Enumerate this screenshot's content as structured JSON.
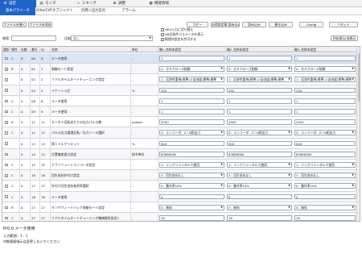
{
  "tabs_top": [
    {
      "label": "設定",
      "icon": "gear-icon",
      "glyph": "⚙"
    },
    {
      "label": "モニタ",
      "icon": "monitor-icon",
      "glyph": "▤"
    },
    {
      "label": "ミキング",
      "icon": "waveform-icon",
      "glyph": "∿"
    },
    {
      "label": "調整",
      "icon": "tune-icon",
      "glyph": "⊞"
    },
    {
      "label": "機能情報",
      "icon": "info-icon",
      "glyph": "▦"
    }
  ],
  "tabs_sub": [
    "基本パラメータ",
    "EtherCATオブジェクト",
    "汎用入出力信号",
    "アラーム"
  ],
  "toolbar": {
    "open_file": "ファイルを開く",
    "save_file": "ファイルを保存",
    "copy": "コピー",
    "factory_reset": "出荷設定値 読み込み",
    "read": "読み込み",
    "write": "書き込み",
    "config": "Config",
    "reset": "リセット",
    "search_label": "検索",
    "search_value": "",
    "compare_label": "比較",
    "compare_value": "なし",
    "hex_label": "HEX入力に切り替え",
    "all_params_label": "AB全条件パラメータを表示",
    "range_label": "範囲外設定を許可する",
    "initialize": "列の表示/非表示"
  },
  "columns": [
    "選択",
    "属性",
    "分類",
    "番号",
    "ID",
    "名称",
    "単位",
    "軸1_名称未設定",
    "軸2_名称未設定",
    "軸3_名称未設定"
  ],
  "rows": [
    {
      "attr": "C",
      "cls": "0",
      "no": "00",
      "id": "0",
      "name": "メータ使用",
      "unit": "-",
      "a1": "1",
      "a2": "1",
      "a3": "1",
      "dd": false
    },
    {
      "attr": "R",
      "cls": "0",
      "no": "01",
      "id": "1",
      "name": "制御モード設定",
      "unit": "-",
      "a1": "0：セミクローズ制御",
      "a2": "0：セミクローズ制御",
      "a3": "0：セミクローズ制御",
      "dd": true
    },
    {
      "attr": "",
      "cls": "0",
      "no": "02",
      "id": "2",
      "name": "リアルタイムオートチューニング設定",
      "unit": "-",
      "a1": "1：応答性重視(標準)２自由度(標準)標準",
      "a2": "1：応答性重視(標準)２自由度(標準)標準",
      "a3": "1：応答性重視(標準)２自由度(標準)標準",
      "dd": true
    },
    {
      "attr": "",
      "cls": "0",
      "no": "04",
      "id": "4",
      "name": "イナーシャ比",
      "unit": "%",
      "a1": "250",
      "a2": "250",
      "a3": "250",
      "dd": false
    },
    {
      "attr": "C",
      "cls": "0",
      "no": "08",
      "id": "8",
      "name": "メータ使用",
      "unit": "-",
      "a1": "1",
      "a2": "1",
      "a3": "1",
      "dd": false
    },
    {
      "attr": "C",
      "cls": "0",
      "no": "09",
      "id": "9",
      "name": "メータ使用",
      "unit": "-",
      "a1": "1",
      "a2": "1",
      "a3": "1",
      "dd": false
    },
    {
      "attr": "R",
      "cls": "0",
      "no": "11",
      "id": "11",
      "name": "モータ１回転あたりの出力パルス数",
      "unit": "pulse/r",
      "a1": "2500",
      "a2": "2500",
      "a3": "2500",
      "dd": false
    },
    {
      "attr": "C",
      "cls": "0",
      "no": "12",
      "id": "12",
      "name": "パルス出力論理反転／出力ソース選択",
      "unit": "-",
      "a1": "0：エンコーダ、Z＝B相出力",
      "a2": "0：エンコーダ、Z＝B相出力",
      "a3": "0：エンコーダ、Z＝B相出力",
      "dd": true
    },
    {
      "attr": "",
      "cls": "0",
      "no": "13",
      "id": "13",
      "name": "第１トルクリミット",
      "unit": "%",
      "a1": "500",
      "a2": "500",
      "a3": "500",
      "dd": false
    },
    {
      "attr": "",
      "cls": "0",
      "no": "14",
      "id": "14",
      "name": "位置偏差過大設定",
      "unit": "指令単位",
      "a1": "83886080",
      "a2": "83886080",
      "a3": "83886080",
      "dd": false
    },
    {
      "attr": "C",
      "cls": "0",
      "no": "15",
      "id": "15",
      "name": "アブソリュートエンコーダ設定",
      "unit": "-",
      "a1": "1：インクリメンタルで使用",
      "a2": "1：インクリメンタルで使用",
      "a3": "1：インクリメンタルで使用",
      "dd": true
    },
    {
      "attr": "C",
      "cls": "0",
      "no": "16",
      "id": "16",
      "name": "回生抵抗外付け設定",
      "unit": "-",
      "a1": "3：回生抵抗なし",
      "a2": "3：回生抵抗なし",
      "a3": "3：回生抵抗なし",
      "dd": true
    },
    {
      "attr": "C",
      "cls": "0",
      "no": "17",
      "id": "17",
      "name": "外付け回生抵抗負荷率選択",
      "unit": "-",
      "a1": "0：動作率10%",
      "a2": "0：動作率10%",
      "a3": "0：動作率10%",
      "dd": true
    },
    {
      "attr": "C",
      "cls": "0",
      "no": "18",
      "id": "18",
      "name": "メータ使用",
      "unit": "-",
      "a1": "0",
      "a2": "0",
      "a3": "0",
      "dd": false
    },
    {
      "attr": "R",
      "cls": "0",
      "no": "27",
      "id": "27",
      "name": "センサフィードバック制御モード設定",
      "unit": "-",
      "a1": "0：無効",
      "a2": "0：無効",
      "a3": "0：無効",
      "dd": true
    },
    {
      "attr": "C",
      "cls": "0",
      "no": "37",
      "id": "37",
      "name": "リアルタイムオートチューニング機械剛性設定1",
      "unit": "-",
      "a1": "16",
      "a2": "16",
      "a3": "16",
      "dd": false
    }
  ],
  "detail": {
    "title": "Pr0.0 メータ使用",
    "line1": "入力範囲：1 - 1",
    "line2": "※数値値指示は変更しないでください"
  }
}
